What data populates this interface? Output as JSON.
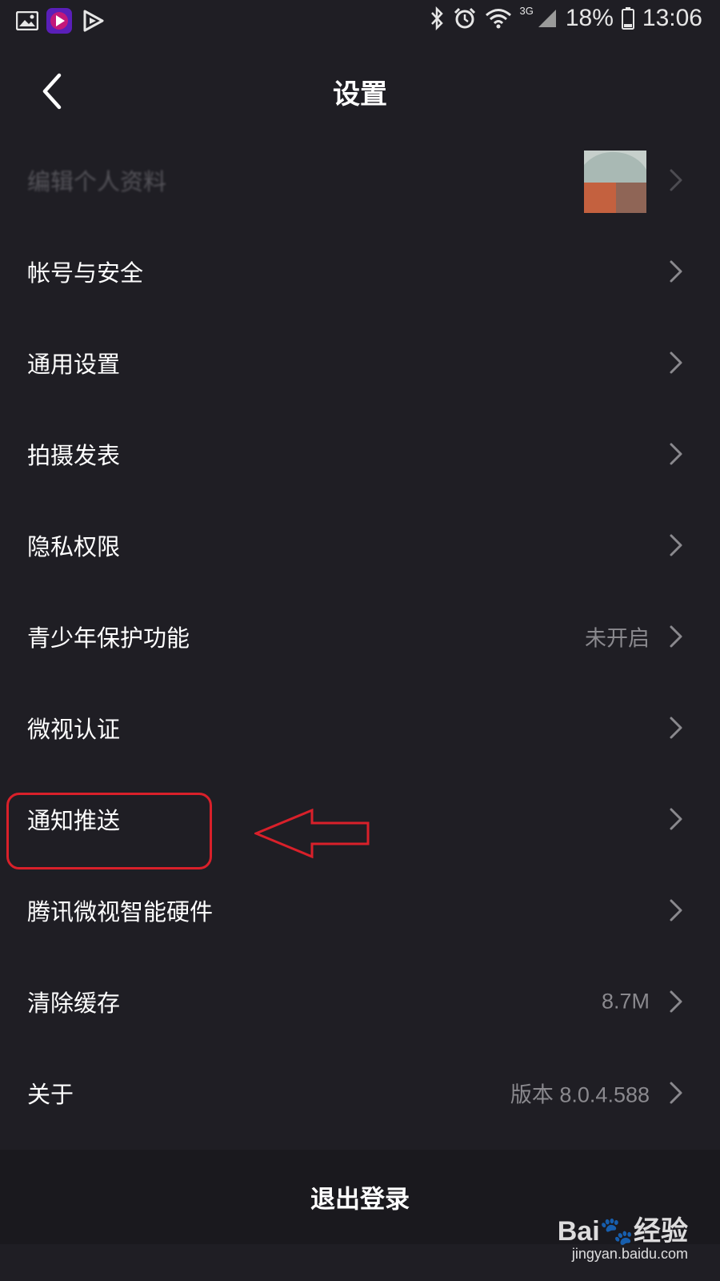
{
  "status_bar": {
    "battery": "18%",
    "time": "13:06",
    "network": "3G",
    "icons": [
      "gallery-icon",
      "video-app-icon",
      "play-app-icon",
      "bluetooth-icon",
      "alarm-icon",
      "wifi-icon",
      "signal-icon",
      "battery-icon"
    ]
  },
  "header": {
    "title": "设置",
    "back_icon": "chevron-left-icon"
  },
  "menu": {
    "items": [
      {
        "label": "编辑个人资料",
        "value": ""
      },
      {
        "label": "帐号与安全",
        "value": ""
      },
      {
        "label": "通用设置",
        "value": ""
      },
      {
        "label": "拍摄发表",
        "value": ""
      },
      {
        "label": "隐私权限",
        "value": ""
      },
      {
        "label": "青少年保护功能",
        "value": "未开启"
      },
      {
        "label": "微视认证",
        "value": ""
      },
      {
        "label": "通知推送",
        "value": ""
      },
      {
        "label": "腾讯微视智能硬件",
        "value": ""
      },
      {
        "label": "清除缓存",
        "value": "8.7M"
      },
      {
        "label": "关于",
        "value": "版本 8.0.4.588"
      }
    ]
  },
  "logout": {
    "label": "退出登录"
  },
  "watermark": {
    "brand": "Bai🐾经验",
    "url": "jingyan.baidu.com"
  },
  "colors": {
    "background": "#1f1e24",
    "text": "#ffffff",
    "secondary_text": "#8a898e",
    "annotation": "#d9202a"
  }
}
